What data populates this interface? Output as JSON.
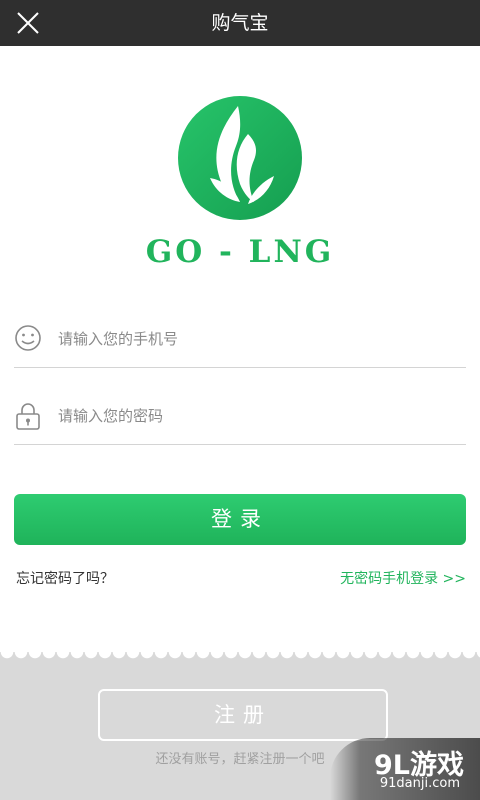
{
  "header": {
    "title": "购气宝",
    "close_icon": "close-icon"
  },
  "logo": {
    "icon": "leaf-flame-logo-icon",
    "text": "GO - LNG",
    "color": "#21b45c"
  },
  "phone_field": {
    "icon": "smiley-face-icon",
    "placeholder": "请输入您的手机号",
    "value": ""
  },
  "password_field": {
    "icon": "lock-icon",
    "placeholder": "请输入您的密码",
    "value": ""
  },
  "login_button": {
    "label": "登录"
  },
  "links": {
    "forgot_password": "忘记密码了吗？",
    "sms_login": "无密码手机登录 >>"
  },
  "register": {
    "button_label": "注册",
    "hint": "还没有账号，赶紧注册一个吧"
  },
  "watermark": {
    "brand": "9L游戏",
    "url": "91danji.com"
  },
  "colors": {
    "accent": "#21b45c",
    "header_bg": "#2f2f2f",
    "bottom_bg": "#d9d9d9"
  }
}
